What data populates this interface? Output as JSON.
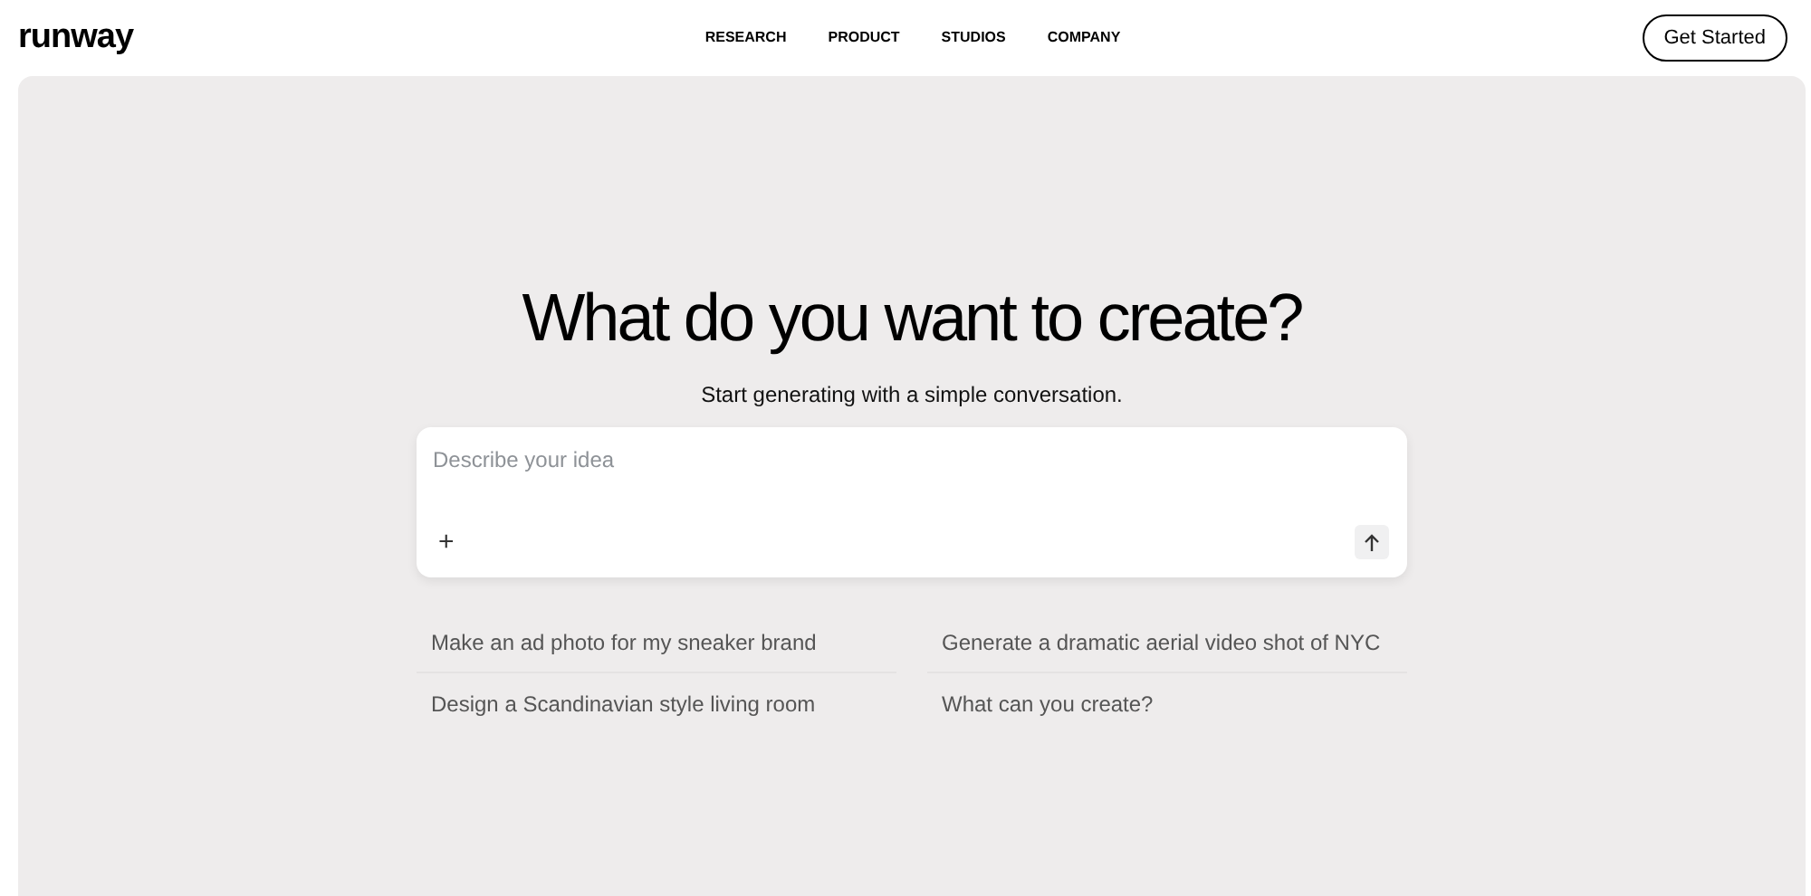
{
  "header": {
    "logo": "runway",
    "nav": [
      "RESEARCH",
      "PRODUCT",
      "STUDIOS",
      "COMPANY"
    ],
    "cta": "Get Started"
  },
  "hero": {
    "title": "What do you want to create?",
    "subtitle": "Start generating with a simple conversation."
  },
  "prompt": {
    "placeholder": "Describe your idea",
    "add": "+"
  },
  "suggestions": [
    "Make an ad photo for my sneaker brand",
    "Generate a dramatic aerial video shot of NYC",
    "Design a Scandinavian style living room",
    "What can you create?"
  ]
}
